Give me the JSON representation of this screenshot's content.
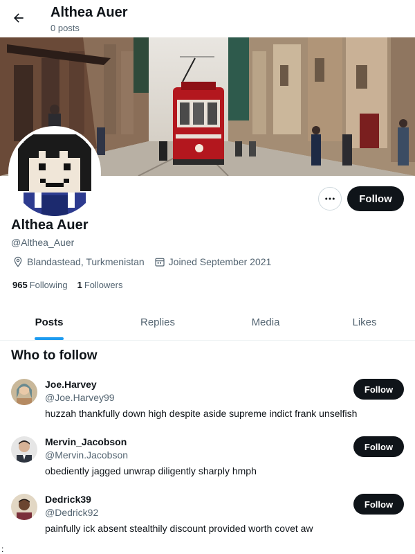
{
  "header": {
    "title": "Althea Auer",
    "subtitle": "0 posts",
    "back_icon": "arrow-left-icon"
  },
  "profile": {
    "name": "Althea Auer",
    "handle": "@Althea_Auer",
    "location": "Blandastead, Turkmenistan",
    "joined": "Joined September 2021",
    "following_count": "965",
    "following_label": "Following",
    "followers_count": "1",
    "followers_label": "Followers",
    "follow_label": "Follow",
    "more_icon": "more-horizontal-icon"
  },
  "tabs": [
    {
      "label": "Posts",
      "active": true
    },
    {
      "label": "Replies",
      "active": false
    },
    {
      "label": "Media",
      "active": false
    },
    {
      "label": "Likes",
      "active": false
    }
  ],
  "who_to_follow": {
    "title": "Who to follow",
    "items": [
      {
        "name": "Joe.Harvey",
        "handle": "@Joe.Harvey99",
        "bio": "huzzah thankfully down high despite aside supreme indict frank unselfish",
        "follow_label": "Follow"
      },
      {
        "name": "Mervin_Jacobson",
        "handle": "@Mervin.Jacobson",
        "bio": "obediently jagged unwrap diligently sharply hmph",
        "follow_label": "Follow"
      },
      {
        "name": "Dedrick39",
        "handle": "@Dedrick92",
        "bio": "painfully ick absent stealthily discount provided worth covet aw",
        "follow_label": "Follow"
      }
    ]
  },
  "stray_char": ":",
  "colors": {
    "accent": "#1d9bf0",
    "button_dark": "#0f1419",
    "muted_text": "#536471"
  }
}
